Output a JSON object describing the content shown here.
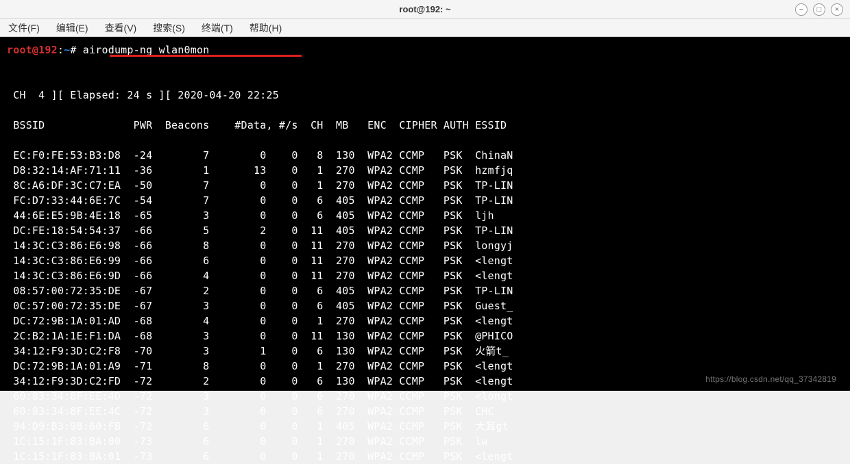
{
  "window": {
    "title": "root@192: ~"
  },
  "menu": {
    "file": "文件(F)",
    "edit": "编辑(E)",
    "view": "查看(V)",
    "search": "搜索(S)",
    "terminal": "终端(T)",
    "help": "帮助(H)"
  },
  "prompt": {
    "user": "root@192",
    "sep": ":",
    "path": "~",
    "hash": "# ",
    "command": "airodump-ng wlan0mon"
  },
  "status": " CH  4 ][ Elapsed: 24 s ][ 2020-04-20 22:25",
  "headers": " BSSID              PWR  Beacons    #Data, #/s  CH  MB   ENC  CIPHER AUTH ESSID",
  "rows": [
    " EC:F0:FE:53:B3:D8  -24        7        0    0   8  130  WPA2 CCMP   PSK  ChinaN",
    " D8:32:14:AF:71:11  -36        1       13    0   1  270  WPA2 CCMP   PSK  hzmfjq",
    " 8C:A6:DF:3C:C7:EA  -50        7        0    0   1  270  WPA2 CCMP   PSK  TP-LIN",
    " FC:D7:33:44:6E:7C  -54        7        0    0   6  405  WPA2 CCMP   PSK  TP-LIN",
    " 44:6E:E5:9B:4E:18  -65        3        0    0   6  405  WPA2 CCMP   PSK  ljh",
    " DC:FE:18:54:54:37  -66        5        2    0  11  405  WPA2 CCMP   PSK  TP-LIN",
    " 14:3C:C3:86:E6:98  -66        8        0    0  11  270  WPA2 CCMP   PSK  longyj",
    " 14:3C:C3:86:E6:99  -66        6        0    0  11  270  WPA2 CCMP   PSK  <lengt",
    " 14:3C:C3:86:E6:9D  -66        4        0    0  11  270  WPA2 CCMP   PSK  <lengt",
    " 08:57:00:72:35:DE  -67        2        0    0   6  405  WPA2 CCMP   PSK  TP-LIN",
    " 0C:57:00:72:35:DE  -67        3        0    0   6  405  WPA2 CCMP   PSK  Guest_",
    " DC:72:9B:1A:01:AD  -68        4        0    0   1  270  WPA2 CCMP   PSK  <lengt",
    " 2C:B2:1A:1E:F1:DA  -68        3        0    0  11  130  WPA2 CCMP   PSK  @PHICO",
    " 34:12:F9:3D:C2:F8  -70        3        1    0   6  130  WPA2 CCMP   PSK  火箭t_",
    " DC:72:9B:1A:01:A9  -71        8        0    0   1  270  WPA2 CCMP   PSK  <lengt",
    " 34:12:F9:3D:C2:FD  -72        2        0    0   6  130  WPA2 CCMP   PSK  <lengt",
    " 60:83:34:8F:EE:4D  -72        3        0    0   6  270  WPA2 CCMP   PSK  <longt",
    " 60:83:34:8F:EE:4C  -72        3        0    0   6  270  WPA2 CCMP   PSK  CHC",
    " 94:D9:B3:98:60:FB  -72        6        0    0   1  405  WPA2 CCMP   PSK  大耳gt",
    " 1C:15:1F:83:BA:00  -73        6        0    0   1  270  WPA2 CCMP   PSK  lw",
    " 1C:15:1F:83:BA:01  -73        6        0    0   1  270  WPA2 CCMP   PSK  <lengt"
  ],
  "watermark": "https://blog.csdn.net/qq_37342819"
}
